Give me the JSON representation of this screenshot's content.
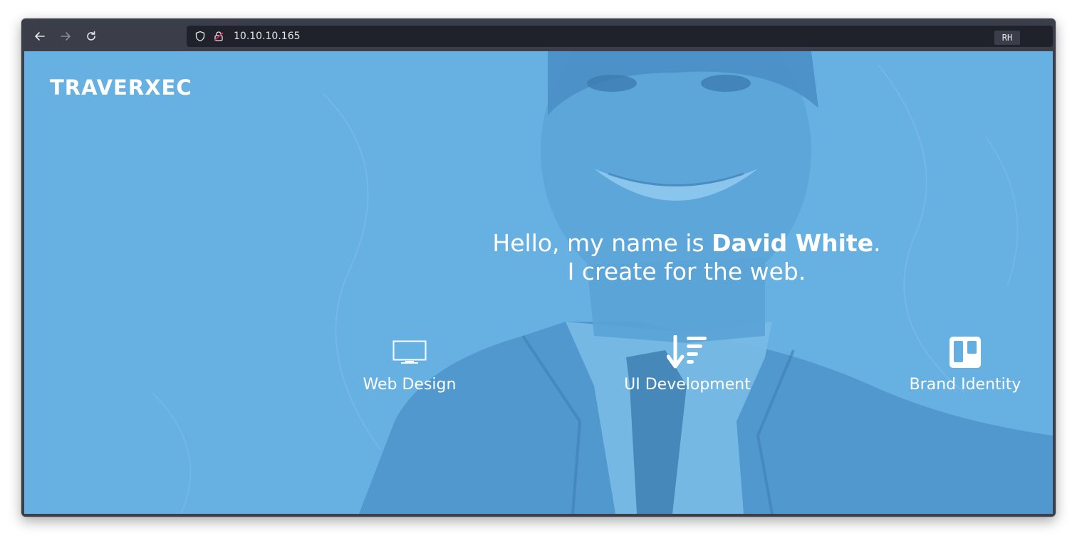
{
  "window": {
    "badge": "RH"
  },
  "browser": {
    "url": "10.10.10.165",
    "icons": [
      "back-arrow-icon",
      "forward-arrow-icon",
      "reload-icon",
      "shield-icon",
      "insecure-lock-icon"
    ]
  },
  "site": {
    "brand": "TRAVERXEC",
    "hero": {
      "line1_prefix": "Hello, my name is ",
      "name": "David White",
      "line1_suffix": ".",
      "line2": "I create for the web."
    },
    "services": [
      {
        "label": "Web Design",
        "icon": "monitor-icon"
      },
      {
        "label": "UI Development",
        "icon": "sort-amount-down-icon"
      },
      {
        "label": "Brand Identity",
        "icon": "trello-board-icon"
      }
    ]
  },
  "colors": {
    "overlay": "#64aee0",
    "browser_chrome": "#3b3d49",
    "urlbar": "#20222b",
    "insecure": "#e22850"
  }
}
